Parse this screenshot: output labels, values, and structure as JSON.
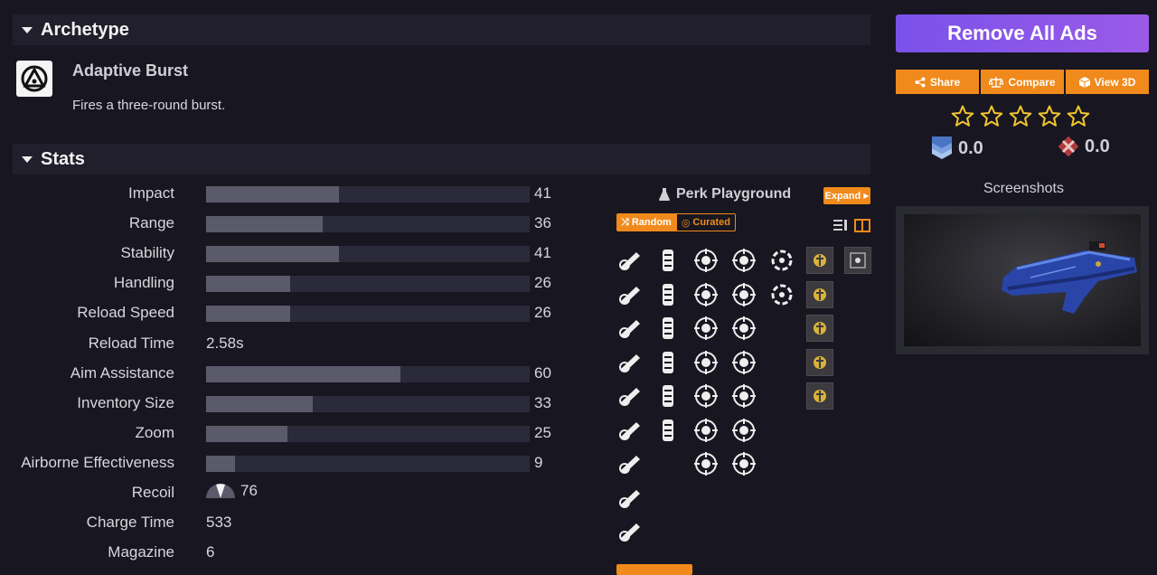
{
  "archetype": {
    "header": "Archetype",
    "name": "Adaptive Burst",
    "description": "Fires a three-round burst."
  },
  "stats": {
    "header": "Stats",
    "rows": [
      {
        "label": "Impact",
        "value": 41,
        "display": "41",
        "type": "bar"
      },
      {
        "label": "Range",
        "value": 36,
        "display": "36",
        "type": "bar"
      },
      {
        "label": "Stability",
        "value": 41,
        "display": "41",
        "type": "bar"
      },
      {
        "label": "Handling",
        "value": 26,
        "display": "26",
        "type": "bar"
      },
      {
        "label": "Reload Speed",
        "value": 26,
        "display": "26",
        "type": "bar"
      },
      {
        "label": "Reload Time",
        "display": "2.58s",
        "type": "text"
      },
      {
        "label": "Aim Assistance",
        "value": 60,
        "display": "60",
        "type": "bar"
      },
      {
        "label": "Inventory Size",
        "value": 33,
        "display": "33",
        "type": "bar"
      },
      {
        "label": "Zoom",
        "value": 25,
        "display": "25",
        "type": "bar"
      },
      {
        "label": "Airborne Effectiveness",
        "value": 9,
        "display": "9",
        "type": "bar"
      },
      {
        "label": "Recoil",
        "display": "76",
        "type": "recoil"
      },
      {
        "label": "Charge Time",
        "display": "533",
        "type": "text"
      },
      {
        "label": "Magazine",
        "display": "6",
        "type": "text"
      }
    ]
  },
  "perk_playground": {
    "title": "Perk Playground",
    "expand_label": "Expand",
    "random_label": "Random",
    "curated_label": "Curated",
    "columns": [
      {
        "icons": [
          "barrel-perk-icon",
          "barrel-perk-icon",
          "barrel-perk-icon",
          "barrel-perk-icon",
          "barrel-perk-icon",
          "barrel-perk-icon",
          "barrel-perk-icon",
          "barrel-perk-icon",
          "barrel-perk-icon"
        ]
      },
      {
        "icons": [
          "magazine-perk-icon",
          "magazine-perk-icon",
          "magazine-perk-icon",
          "magazine-perk-icon",
          "magazine-perk-icon",
          "magazine-perk-icon"
        ]
      },
      {
        "icons": [
          "trait-perk-icon",
          "trait-perk-icon",
          "trait-perk-icon",
          "trait-perk-icon",
          "trait-perk-icon",
          "trait-perk-icon",
          "trait-perk-icon"
        ]
      },
      {
        "icons": [
          "trait-perk-icon",
          "trait-perk-icon",
          "trait-perk-icon",
          "trait-perk-icon",
          "trait-perk-icon",
          "trait-perk-icon",
          "trait-perk-icon"
        ]
      },
      {
        "icons": [
          "origin-perk-icon",
          "origin-perk-icon"
        ]
      },
      {
        "icons": [
          "masterwork-icon",
          "masterwork-icon",
          "masterwork-icon",
          "masterwork-icon",
          "masterwork-icon"
        ]
      },
      {
        "icons": [
          "mod-slot-icon"
        ]
      }
    ]
  },
  "sidebar": {
    "remove_ads_label": "Remove All Ads",
    "share_label": "Share",
    "compare_label": "Compare",
    "view3d_label": "View 3D",
    "star_rating": 0,
    "star_count": 5,
    "pve_score": "0.0",
    "pvp_score": "0.0",
    "screenshots_label": "Screenshots"
  },
  "colors": {
    "accent_orange": "#f08a1c",
    "ads_purple": "#8a56ea",
    "star_gold": "#f2c62e",
    "bg": "#181721"
  }
}
